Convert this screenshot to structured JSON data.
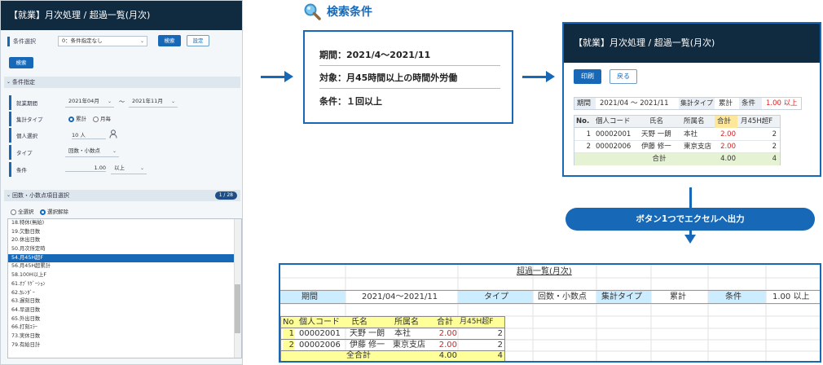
{
  "app": {
    "title": "【就業】月次処理 / 超過一覧(月次)",
    "cond_select": {
      "label": "条件選択",
      "value": "0：条件指定なし",
      "search": "検索",
      "settings": "設定"
    },
    "search_btn": "検索",
    "cond_section": "条件指定",
    "fields": {
      "period_label": "就業期間",
      "period_from": "2021年04月",
      "tilde": "～",
      "period_to": "2021年11月",
      "type_label": "集計タイプ",
      "type_opt1": "累計",
      "type_opt2": "月毎",
      "person_label": "個人選択",
      "person_value": "10 人",
      "kind_label": "タイプ",
      "kind_value": "回数・小数点",
      "cond_label": "条件",
      "cond_value": "1.00",
      "cond_op": "以上"
    },
    "items_section": "回数・小数点項目選択",
    "items_count": "1 / 28",
    "select_all": "全選択",
    "deselect_all": "選択解除",
    "items": [
      "18.特休(無給)",
      "19.欠勤日数",
      "20.休出日数",
      "50.月次所定時",
      "54.月45H超F",
      "56.月45H超累計",
      "58.100H以上F",
      "61.ｵﾌﾞﾘｹﾞｰｼｮﾝ",
      "62.ｶﾚﾝﾀﾞｰ",
      "63.遅刻日数",
      "64.早退日数",
      "65.外出日数",
      "66.打刻ｴﾗｰ",
      "73.実休日数",
      "79.有給日計"
    ]
  },
  "criteria": {
    "heading": "検索条件",
    "line1": "期間：2021/4～2021/11",
    "line2": "対象：月45時間以上の時間外労働",
    "line3": "条件：１回以上"
  },
  "report": {
    "title": "【就業】月次処理 / 超過一覧(月次)",
    "print": "印刷",
    "back": "戻る",
    "info": [
      "期間",
      "2021/04 ～ 2021/11",
      "集計タイプ",
      "累計",
      "条件",
      "1.00 以上"
    ],
    "headers": [
      "No.",
      "個人コード",
      "氏名",
      "所属名",
      "合計",
      "月45H超F"
    ],
    "rows": [
      [
        "1",
        "00002001",
        "天野 一朗",
        "本社",
        "2.00",
        "2"
      ],
      [
        "2",
        "00002006",
        "伊藤 修一",
        "東京支店",
        "2.00",
        "2"
      ]
    ],
    "total": [
      "合計",
      "4.00",
      "4"
    ]
  },
  "export_label": "ボタン1つでエクセルへ出力",
  "excel": {
    "title": "超過一覧(月次)",
    "info": [
      "期間",
      "2021/04～2021/11",
      "タイプ",
      "回数・小数点",
      "集計タイプ",
      "累計",
      "条件",
      "1.00 以上"
    ],
    "headers": [
      "No",
      "個人コード",
      "氏名",
      "所属名",
      "合計",
      "月45H超F"
    ],
    "rows": [
      [
        "1",
        "00002001",
        "天野 一朗",
        "本社",
        "2.00",
        "2"
      ],
      [
        "2",
        "00002006",
        "伊藤 修一",
        "東京支店",
        "2.00",
        "2"
      ]
    ],
    "total": [
      "全合計",
      "4.00",
      "4"
    ]
  },
  "colors": {
    "navy": "#102a3f",
    "accent": "#1769b8",
    "excel_header": "#ccecff",
    "excel_total": "#ffff99",
    "red": "#e02020"
  }
}
